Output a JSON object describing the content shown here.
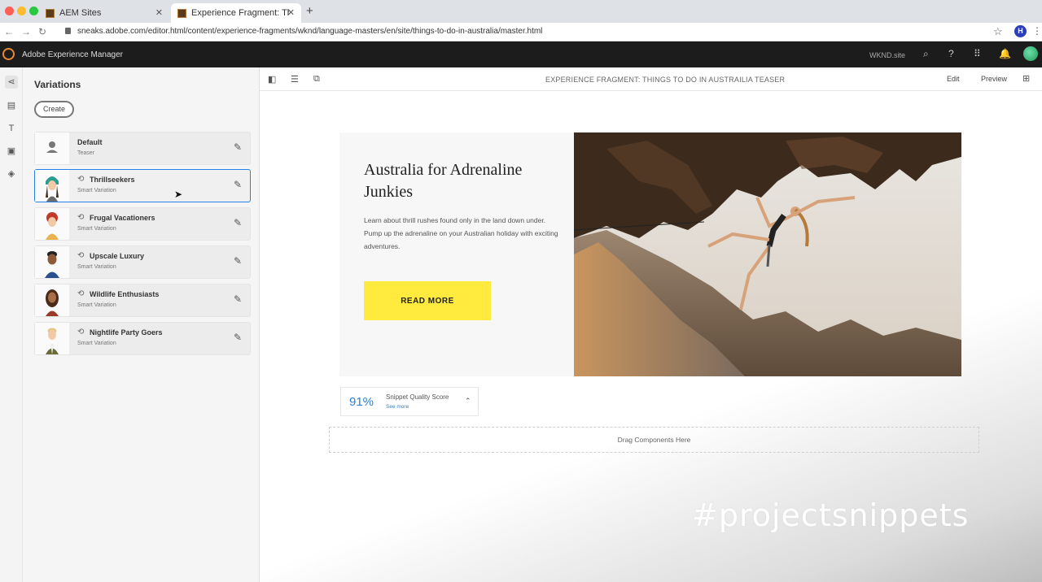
{
  "browser": {
    "tabs": [
      {
        "title": "AEM Sites"
      },
      {
        "title": "Experience Fragment: Thi..."
      }
    ],
    "url": "sneaks.adobe.com/editor.html/content/experience-fragments/wknd/language-masters/en/site/things-to-do-in-australia/master.html",
    "profile_initial": "H"
  },
  "app": {
    "title": "Adobe Experience Manager",
    "site": "WKND.site"
  },
  "panel": {
    "title": "Variations",
    "create_label": "Create",
    "items": [
      {
        "name": "Default",
        "subtitle": "Teaser"
      },
      {
        "name": "Thrillseekers",
        "subtitle": "Smart Variation"
      },
      {
        "name": "Frugal Vacationers",
        "subtitle": "Smart Variation"
      },
      {
        "name": "Upscale Luxury",
        "subtitle": "Smart Variation"
      },
      {
        "name": "Wildlife Enthusiasts",
        "subtitle": "Smart Variation"
      },
      {
        "name": "Nightlife Party Goers",
        "subtitle": "Smart Variation"
      }
    ]
  },
  "toolbar": {
    "breadcrumb": "EXPERIENCE FRAGMENT:   THINGS TO DO IN AUSTRAILIA TEASER",
    "edit_label": "Edit",
    "preview_label": "Preview"
  },
  "teaser": {
    "title": "Australia for Adrenaline Junkies",
    "description": "Learn about thrill rushes found only in the land down under. Pump up the adrenaline on your Australian holiday with exciting adventures.",
    "cta_label": "READ MORE"
  },
  "snippet_score": {
    "value": "91%",
    "label": "Snippet Quality Score",
    "link": "See more"
  },
  "dropzone": {
    "label": "Drag Components Here"
  },
  "watermark": "#projectsnippets",
  "colors": {
    "accent_blue": "#2680eb",
    "cta_yellow": "#ffea3d",
    "header_dark": "#1c1c1c"
  }
}
